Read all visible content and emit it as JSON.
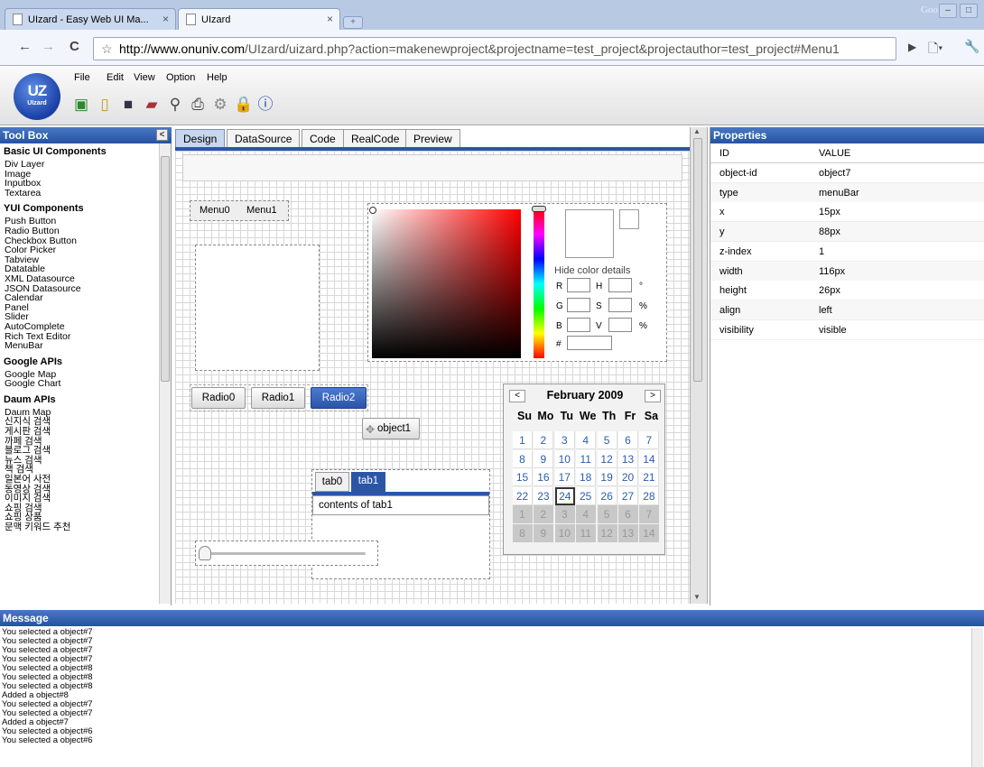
{
  "browser": {
    "tabs": [
      {
        "title": "UIzard - Easy Web UI Ma..."
      },
      {
        "title": "UIzard"
      }
    ],
    "google_label": "Google",
    "url_host": "http://www.onuniv.com",
    "url_path": "/UIzard/uizard.php?action=makenewproject&projectname=test_project&projectauthor=test_project#Menu1"
  },
  "app": {
    "logo_text": "UZ",
    "logo_sub": "UIzard",
    "menu": [
      "File",
      "Edit",
      "View",
      "Option",
      "Help"
    ]
  },
  "toolbox": {
    "title": "Tool Box",
    "sections": [
      {
        "name": "Basic UI Components",
        "items": [
          "Div Layer",
          "Image",
          "Inputbox",
          "Textarea"
        ]
      },
      {
        "name": "YUI Components",
        "items": [
          "Push Button",
          "Radio Button",
          "Checkbox Button",
          "Color Picker",
          "Tabview",
          "Datatable",
          "XML Datasource",
          "JSON Datasource",
          "Calendar",
          "Panel",
          "Slider",
          "AutoComplete",
          "Rich Text Editor",
          "MenuBar"
        ]
      },
      {
        "name": "Google APIs",
        "items": [
          "Google Map",
          "Google Chart"
        ]
      },
      {
        "name": "Daum APIs",
        "items": [
          "Daum Map",
          "신지식 검색",
          "게시판 검색",
          "까페 검색",
          "블로그 검색",
          "뉴스 검색",
          "책 검색",
          "일본어 사전",
          "동영상 검색",
          "이미지 검색",
          "쇼핑 검색",
          "쇼핑 상품",
          "문맥 키워드 추천"
        ]
      }
    ]
  },
  "editor": {
    "tabs": [
      "Design",
      "DataSource",
      "Code",
      "RealCode",
      "Preview"
    ],
    "menubar_items": [
      "Menu0",
      "Menu1"
    ],
    "radios": [
      "Radio0",
      "Radio1",
      "Radio2"
    ],
    "object_button": "object1",
    "tabview": {
      "tabs": [
        "tab0",
        "tab1"
      ],
      "content": "contents of tab1"
    },
    "color_picker": {
      "hide_details": "Hide color details",
      "labels": [
        "R",
        "H",
        "°",
        "G",
        "S",
        "%",
        "B",
        "V",
        "%",
        "#"
      ]
    },
    "calendar": {
      "month": "February 2009",
      "prev": "<",
      "next": ">",
      "weekdays": [
        "Su",
        "Mo",
        "Tu",
        "We",
        "Th",
        "Fr",
        "Sa"
      ],
      "weeks": [
        [
          "1",
          "2",
          "3",
          "4",
          "5",
          "6",
          "7"
        ],
        [
          "8",
          "9",
          "10",
          "11",
          "12",
          "13",
          "14"
        ],
        [
          "15",
          "16",
          "17",
          "18",
          "19",
          "20",
          "21"
        ],
        [
          "22",
          "23",
          "24",
          "25",
          "26",
          "27",
          "28"
        ],
        [
          "1",
          "2",
          "3",
          "4",
          "5",
          "6",
          "7"
        ],
        [
          "8",
          "9",
          "10",
          "11",
          "12",
          "13",
          "14"
        ]
      ],
      "today": "24"
    },
    "slider_value": 0
  },
  "properties": {
    "title": "Properties",
    "headers": [
      "ID",
      "VALUE"
    ],
    "rows": [
      [
        "object-id",
        "object7"
      ],
      [
        "type",
        "menuBar"
      ],
      [
        "x",
        "15px"
      ],
      [
        "y",
        "88px"
      ],
      [
        "z-index",
        "1"
      ],
      [
        "width",
        "116px"
      ],
      [
        "height",
        "26px"
      ],
      [
        "align",
        "left"
      ],
      [
        "visibility",
        "visible"
      ]
    ]
  },
  "message": {
    "title": "Message",
    "lines": [
      "You selected a object#7",
      "You selected a object#7",
      "You selected a object#7",
      "You selected a object#7",
      "You selected a object#8",
      "You selected a object#8",
      "You selected a object#8",
      "Added a object#8",
      "You selected a object#7",
      "You selected a object#7",
      "Added a object#7",
      "You selected a object#6",
      "You selected a object#6"
    ]
  }
}
